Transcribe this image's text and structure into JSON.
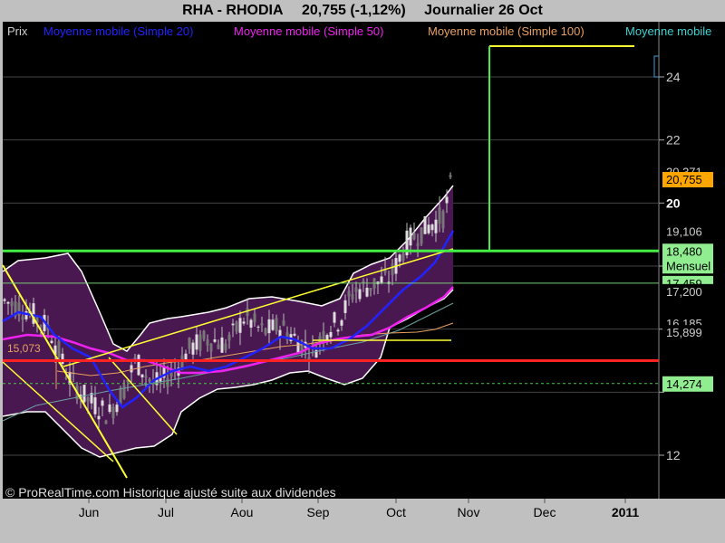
{
  "header": {
    "symbol": "RHA - RHODIA",
    "quote": "20,755 (-1,12%)",
    "period": "Journalier  26 Oct"
  },
  "legend": [
    {
      "label": "Prix",
      "color": "#cccccc"
    },
    {
      "label": "Moyenne mobile (Simple 20)",
      "color": "#2222ff"
    },
    {
      "label": "Moyenne mobile (Simple 50)",
      "color": "#ee22ee"
    },
    {
      "label": "Moyenne mobile (Simple 100)",
      "color": "#e8a060"
    },
    {
      "label": "Moyenne mobile",
      "color": "#40d0d0"
    }
  ],
  "footer": "© ProRealTime.com Historique ajusté suite aux dividendes",
  "annotations": {
    "left_level_label": "15,073",
    "mensuel_label": "Mensuel"
  },
  "chart_data": {
    "type": "candlestick",
    "x_ticks": [
      "Jun",
      "Jul",
      "Aou",
      "Sep",
      "Oct",
      "Nov",
      "Dec",
      "2011"
    ],
    "y_ticks": [
      12,
      14,
      16,
      18,
      20,
      22,
      24
    ],
    "y_tick_labels": [
      "12",
      "",
      "",
      "",
      "20",
      "22",
      "24"
    ],
    "ylim": [
      11,
      25.5
    ],
    "last_price": 20.755,
    "price_labels": [
      {
        "text": "20,371",
        "value": 21.0,
        "bg": "#000000",
        "fg": "#cccccc"
      },
      {
        "text": "20,755",
        "value": 20.755,
        "bg": "#ffa500",
        "fg": "#000000"
      },
      {
        "text": "19,106",
        "value": 19.106,
        "bg": "#000000",
        "fg": "#cccccc"
      },
      {
        "text": "18,480",
        "value": 18.48,
        "bg": "#90ee90",
        "fg": "#000000"
      },
      {
        "text": "17,459",
        "value": 17.459,
        "bg": "#90ee90",
        "fg": "#000000"
      },
      {
        "text": "17,200",
        "value": 17.2,
        "bg": "#000000",
        "fg": "#cccccc"
      },
      {
        "text": "16,185",
        "value": 16.185,
        "bg": "#000000",
        "fg": "#cccccc"
      },
      {
        "text": "15,899",
        "value": 15.899,
        "bg": "#000000",
        "fg": "#cccccc"
      },
      {
        "text": "14,274",
        "value": 14.274,
        "bg": "#90ee90",
        "fg": "#000000"
      }
    ],
    "horizontal_levels": [
      {
        "value": 18.48,
        "color": "#44ee44",
        "width": 3
      },
      {
        "value": 15.0,
        "color": "#ff2222",
        "width": 3
      },
      {
        "value": 14.274,
        "color": "#44cc44",
        "width": 1,
        "dash": "3,3"
      },
      {
        "value": 17.459,
        "color": "#77cc77",
        "width": 1
      }
    ]
  }
}
